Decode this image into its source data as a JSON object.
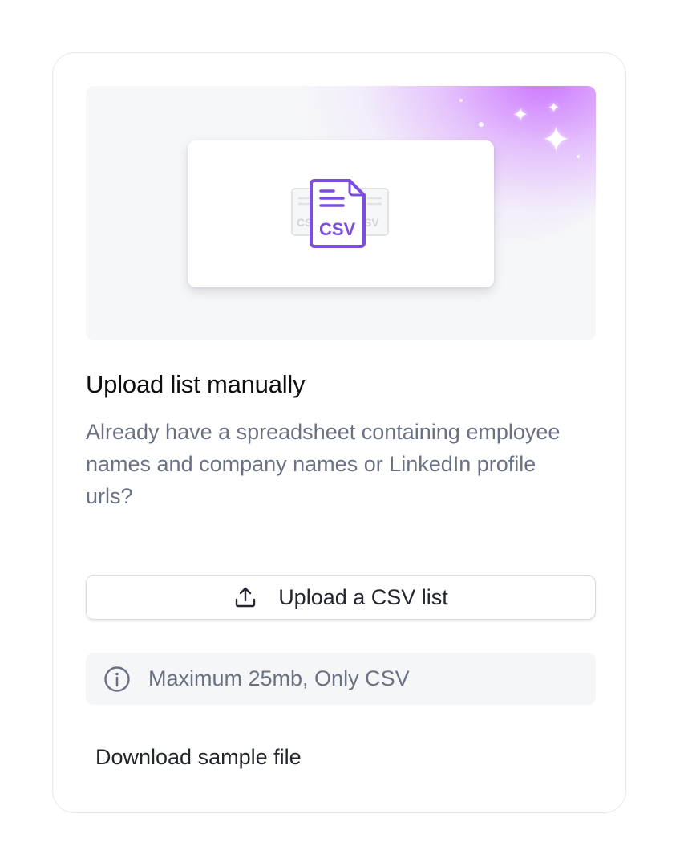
{
  "card": {
    "title": "Upload list manually",
    "description": "Already have a spreadsheet containing employee names and company names or LinkedIn profile urls?",
    "illustration": {
      "file_label": "CSV",
      "back_label_left": "CS",
      "back_label_right": "SV",
      "icon": "csv-file-icon",
      "accent_color": "#7c4dde"
    },
    "upload_button": {
      "label": "Upload a CSV list",
      "icon": "upload-icon"
    },
    "info": {
      "text": "Maximum 25mb, Only CSV",
      "icon": "info-icon"
    },
    "download_link": {
      "label": "Download sample file"
    }
  }
}
